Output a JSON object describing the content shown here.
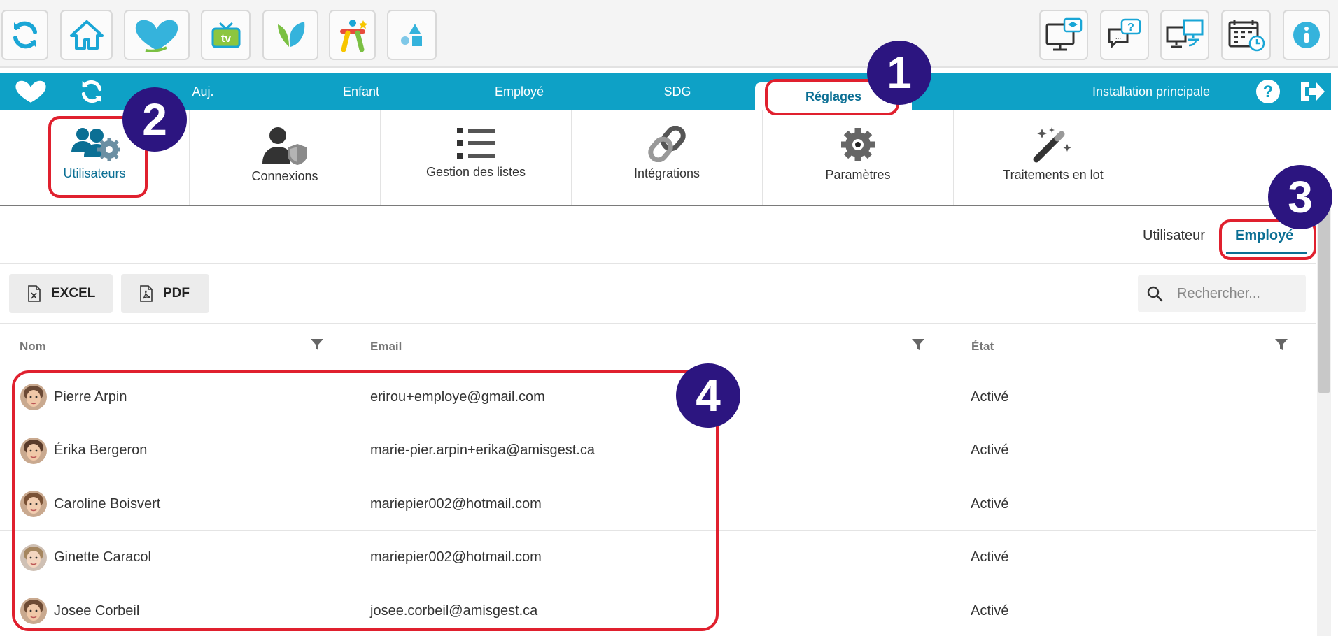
{
  "launcher": {
    "left_icons": [
      "refresh-icon",
      "home-icon",
      "butterfly-logo-icon",
      "tv-icon",
      "leaf-icon",
      "kids-app-icon",
      "shapes-icon"
    ],
    "right_icons": [
      "training-icon",
      "help-chat-icon",
      "sync-screens-icon",
      "calendar-clock-icon",
      "info-icon"
    ]
  },
  "nav": {
    "tabs": [
      "Auj.",
      "Enfant",
      "Employé",
      "SDG",
      "Réglages"
    ],
    "active_tab": "Réglages",
    "installation": "Installation principale"
  },
  "subnav": {
    "items": [
      "Utilisateurs",
      "Connexions",
      "Gestion des listes",
      "Intégrations",
      "Paramètres",
      "Traitements en lot"
    ],
    "active": "Utilisateurs"
  },
  "view_toggle": {
    "options": [
      "Utilisateur",
      "Employé"
    ],
    "active": "Employé"
  },
  "toolbar": {
    "excel_label": "EXCEL",
    "pdf_label": "PDF",
    "search_placeholder": "Rechercher..."
  },
  "table": {
    "columns": [
      "Nom",
      "Email",
      "État"
    ],
    "rows": [
      {
        "name": "Pierre Arpin",
        "email": "erirou+employe@gmail.com",
        "state": "Activé"
      },
      {
        "name": "Érika Bergeron",
        "email": "marie-pier.arpin+erika@amisgest.ca",
        "state": "Activé"
      },
      {
        "name": "Caroline Boisvert",
        "email": "mariepier002@hotmail.com",
        "state": "Activé"
      },
      {
        "name": "Ginette Caracol",
        "email": "mariepier002@hotmail.com",
        "state": "Activé"
      },
      {
        "name": "Josee Corbeil",
        "email": "josee.corbeil@amisgest.ca",
        "state": "Activé"
      }
    ]
  },
  "annotations": [
    "1",
    "2",
    "3",
    "4"
  ],
  "colors": {
    "nav_blue": "#0ea1c6",
    "accent": "#0b6f94",
    "highlight_red": "#e0202e",
    "badge_purple": "#2c1580"
  }
}
